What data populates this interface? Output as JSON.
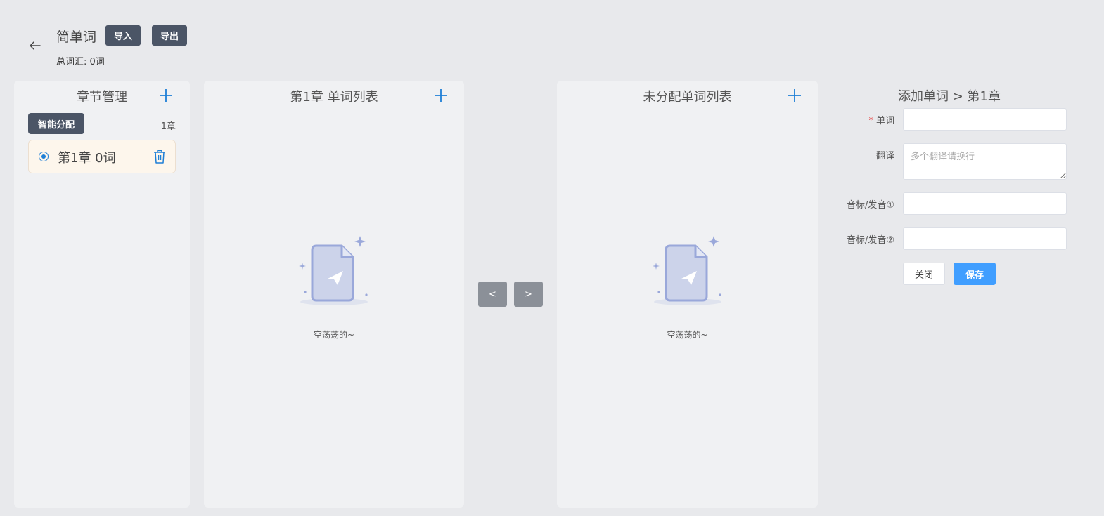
{
  "header": {
    "title": "简单词",
    "import_label": "导入",
    "export_label": "导出",
    "total_vocab": "总词汇: 0词"
  },
  "chapters_panel": {
    "title": "章节管理",
    "smart_assign_label": "智能分配",
    "chapter_count": "1章",
    "items": [
      {
        "label": "第1章  0词",
        "selected": true
      }
    ]
  },
  "chapter_word_list": {
    "title": "第1章 单词列表",
    "empty_text": "空荡荡的~"
  },
  "transfer_buttons": {
    "left_label": "<",
    "right_label": ">"
  },
  "unassigned_word_list": {
    "title": "未分配单词列表",
    "empty_text": "空荡荡的~"
  },
  "add_word_form": {
    "title": "添加单词 > 第1章",
    "word_label": "单词",
    "word_required_mark": "*",
    "word_value": "",
    "translation_label": "翻译",
    "translation_placeholder": "多个翻译请换行",
    "phonetic1_label": "音标/发音①",
    "phonetic1_value": "",
    "phonetic2_label": "音标/发音②",
    "phonetic2_value": "",
    "close_label": "关闭",
    "save_label": "保存"
  },
  "colors": {
    "background": "#e8e9ec",
    "panel": "#f0f1f3",
    "dark_button": "#4b5566",
    "accent_blue": "#1e7fd6",
    "primary_button": "#409eff",
    "selected_item_bg": "#fdf6ec",
    "transfer_button": "#8b9098"
  },
  "icons": [
    "back-arrow-icon",
    "plus-icon",
    "radio-selected-icon",
    "trash-icon",
    "empty-document-icon"
  ]
}
